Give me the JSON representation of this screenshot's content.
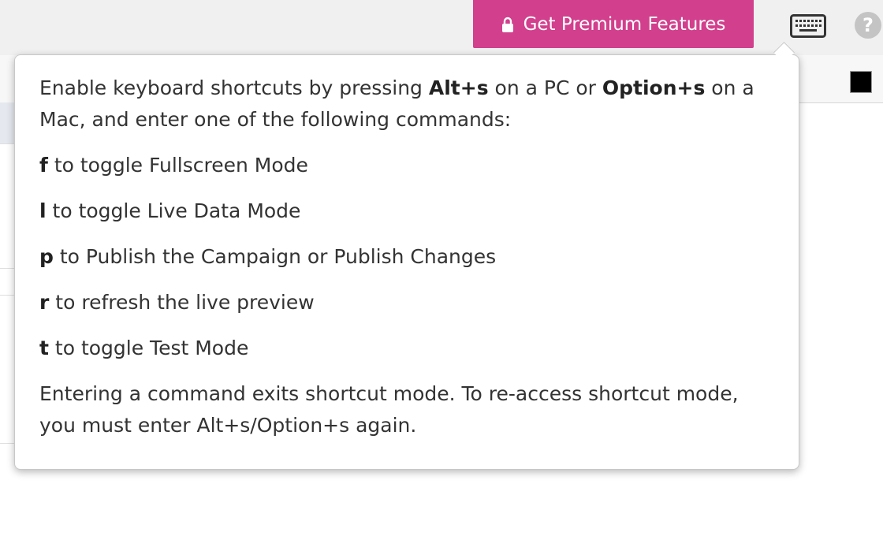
{
  "toolbar": {
    "premium_label": "Get Premium Features",
    "premium_color": "#d23f8d",
    "lock_icon": "lock-icon",
    "keyboard_icon": "keyboard-icon",
    "help_label": "?"
  },
  "popover": {
    "intro": {
      "t1": "Enable keyboard shortcuts by pressing ",
      "k1": "Alt+s",
      "t2": " on a PC or ",
      "k2": "Option+s",
      "t3": " on a Mac, and enter one of the following commands:"
    },
    "commands": [
      {
        "key": "f",
        "text": " to toggle Fullscreen Mode"
      },
      {
        "key": "l",
        "text": " to toggle Live Data Mode"
      },
      {
        "key": "p",
        "text": " to Publish the Campaign or Publish Changes"
      },
      {
        "key": "r",
        "text": " to refresh the live preview"
      },
      {
        "key": "t",
        "text": " to toggle Test Mode"
      }
    ],
    "footer": "Entering a command exits shortcut mode. To re-access shortcut mode, you must enter Alt+s/Option+s again."
  },
  "swatch_color": "#000000"
}
